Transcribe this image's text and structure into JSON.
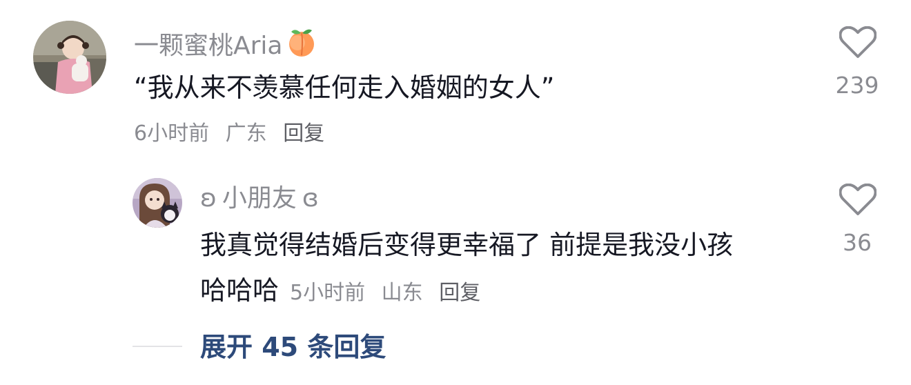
{
  "comments": [
    {
      "username": "一颗蜜桃Aria",
      "username_emoji_icon": "peach-icon",
      "text": "“我从来不羡慕任何走入婚姻的女人”",
      "time": "6小时前",
      "location": "广东",
      "reply_label": "回复",
      "likes": "239"
    }
  ],
  "replies": [
    {
      "username_prefix": "ʚ",
      "username": "小朋友",
      "username_suffix": "ɞ",
      "text_line1": "我真觉得结婚后变得更幸福了 前提是我没小孩",
      "text_line2": "哈哈哈",
      "time": "5小时前",
      "location": "山东",
      "reply_label": "回复",
      "likes": "36"
    }
  ],
  "expand": {
    "label": "展开 45 条回复"
  },
  "colors": {
    "text_primary": "#161823",
    "text_secondary": "#8a8b91",
    "link": "#2d4a7a"
  }
}
